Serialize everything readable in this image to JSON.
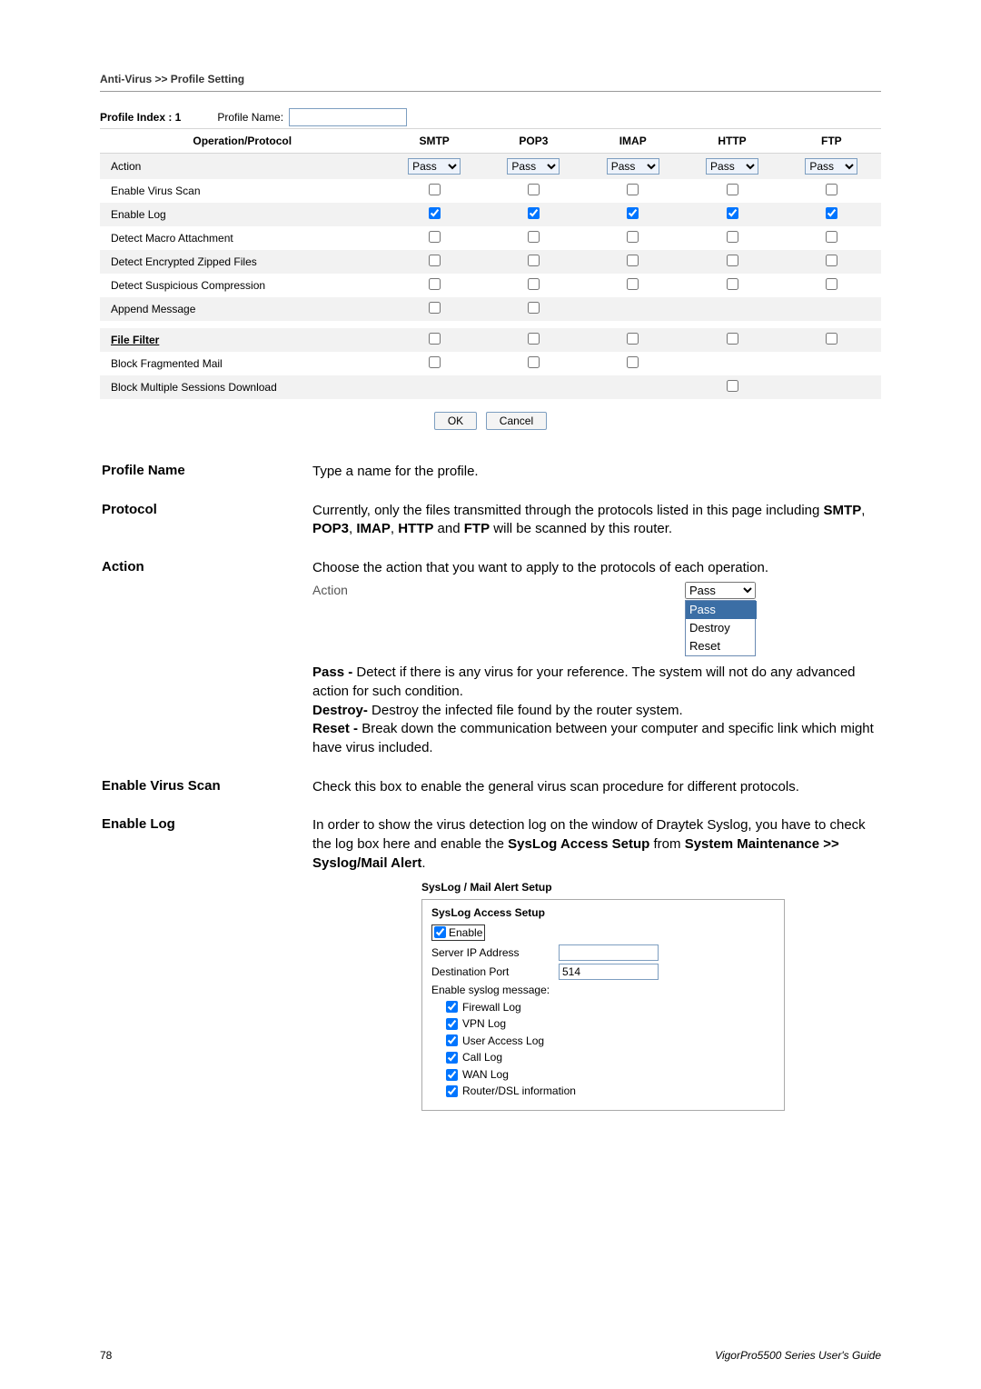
{
  "breadcrumb": "Anti-Virus >> Profile Setting",
  "profile_header": {
    "index_label": "Profile Index : 1",
    "name_label": "Profile Name:",
    "name_value": ""
  },
  "table": {
    "headers": [
      "Operation/Protocol",
      "SMTP",
      "POP3",
      "IMAP",
      "HTTP",
      "FTP"
    ],
    "action_label": "Action",
    "action_values": [
      "Pass",
      "Pass",
      "Pass",
      "Pass",
      "Pass"
    ],
    "rows": [
      {
        "label": "Enable Virus Scan",
        "cells": [
          false,
          false,
          false,
          false,
          false
        ]
      },
      {
        "label": "Enable Log",
        "cells": [
          true,
          true,
          true,
          true,
          true
        ]
      },
      {
        "label": "Detect Macro Attachment",
        "cells": [
          false,
          false,
          false,
          false,
          false
        ]
      },
      {
        "label": "Detect Encrypted Zipped Files",
        "cells": [
          false,
          false,
          false,
          false,
          false
        ]
      },
      {
        "label": "Detect Suspicious Compression",
        "cells": [
          false,
          false,
          false,
          false,
          false
        ]
      },
      {
        "label": "Append Message",
        "cells": [
          false,
          false,
          null,
          null,
          null
        ]
      }
    ],
    "file_filter_label": "File Filter",
    "file_filter_cells": [
      false,
      false,
      false,
      false,
      false
    ],
    "block_frag_label": "Block Fragmented Mail",
    "block_frag_cells": [
      false,
      false,
      false,
      null,
      null
    ],
    "block_multi_label": "Block Multiple Sessions Download",
    "block_multi_cells": [
      null,
      null,
      null,
      false,
      null
    ]
  },
  "buttons": {
    "ok": "OK",
    "cancel": "Cancel"
  },
  "defs": {
    "profile_name": {
      "term": "Profile Name",
      "desc": "Type a name for the profile."
    },
    "protocol": {
      "term": "Protocol",
      "desc": "Currently, only the files transmitted through the protocols listed in this page including ",
      "b1": "SMTP",
      "c1": ", ",
      "b2": "POP3",
      "c2": ", ",
      "b3": "IMAP",
      "c3": ", ",
      "b4": "HTTP",
      "desc2": " and ",
      "b5": "FTP",
      "desc3": " will be scanned by this router."
    },
    "action": {
      "term": "Action",
      "desc": "Choose the action that you want to apply to the protocols of each operation.",
      "dropdown_label": "Action",
      "dropdown_value": "Pass",
      "options": [
        "Pass",
        "Destroy",
        "Reset"
      ],
      "pass_label": "Pass - ",
      "pass_text": "Detect if there is any virus for your reference. The system will not do any advanced action for such condition.",
      "destroy_label": "Destroy- ",
      "destroy_text": "Destroy the infected file found by the router system.",
      "reset_label": "Reset - ",
      "reset_text": "Break down the communication between your computer and specific link which might have virus included."
    },
    "enable_virus": {
      "term": "Enable Virus Scan",
      "desc": "Check this box to enable the general virus scan procedure for different protocols."
    },
    "enable_log": {
      "term": "Enable Log",
      "desc": "In order to show the virus detection log on the window of Draytek Syslog, you have to check the log box here and enable the ",
      "b1": "SysLog Access Setup",
      "desc2": " from ",
      "b2": "System Maintenance >> Syslog/Mail Alert",
      "desc3": "."
    }
  },
  "syslog": {
    "title": "SysLog / Mail Alert Setup",
    "access_setup": "SysLog Access Setup",
    "enable": "Enable",
    "server_ip": "Server IP Address",
    "server_ip_value": "",
    "dest_port": "Destination Port",
    "dest_port_value": "514",
    "enable_msg": "Enable syslog message:",
    "items": [
      {
        "label": "Firewall Log",
        "checked": true
      },
      {
        "label": "VPN Log",
        "checked": true
      },
      {
        "label": "User Access Log",
        "checked": true
      },
      {
        "label": "Call Log",
        "checked": true
      },
      {
        "label": "WAN Log",
        "checked": true
      },
      {
        "label": "Router/DSL information",
        "checked": true
      }
    ]
  },
  "footer": {
    "page": "78",
    "guide": "VigorPro5500  Series  User's Guide"
  }
}
